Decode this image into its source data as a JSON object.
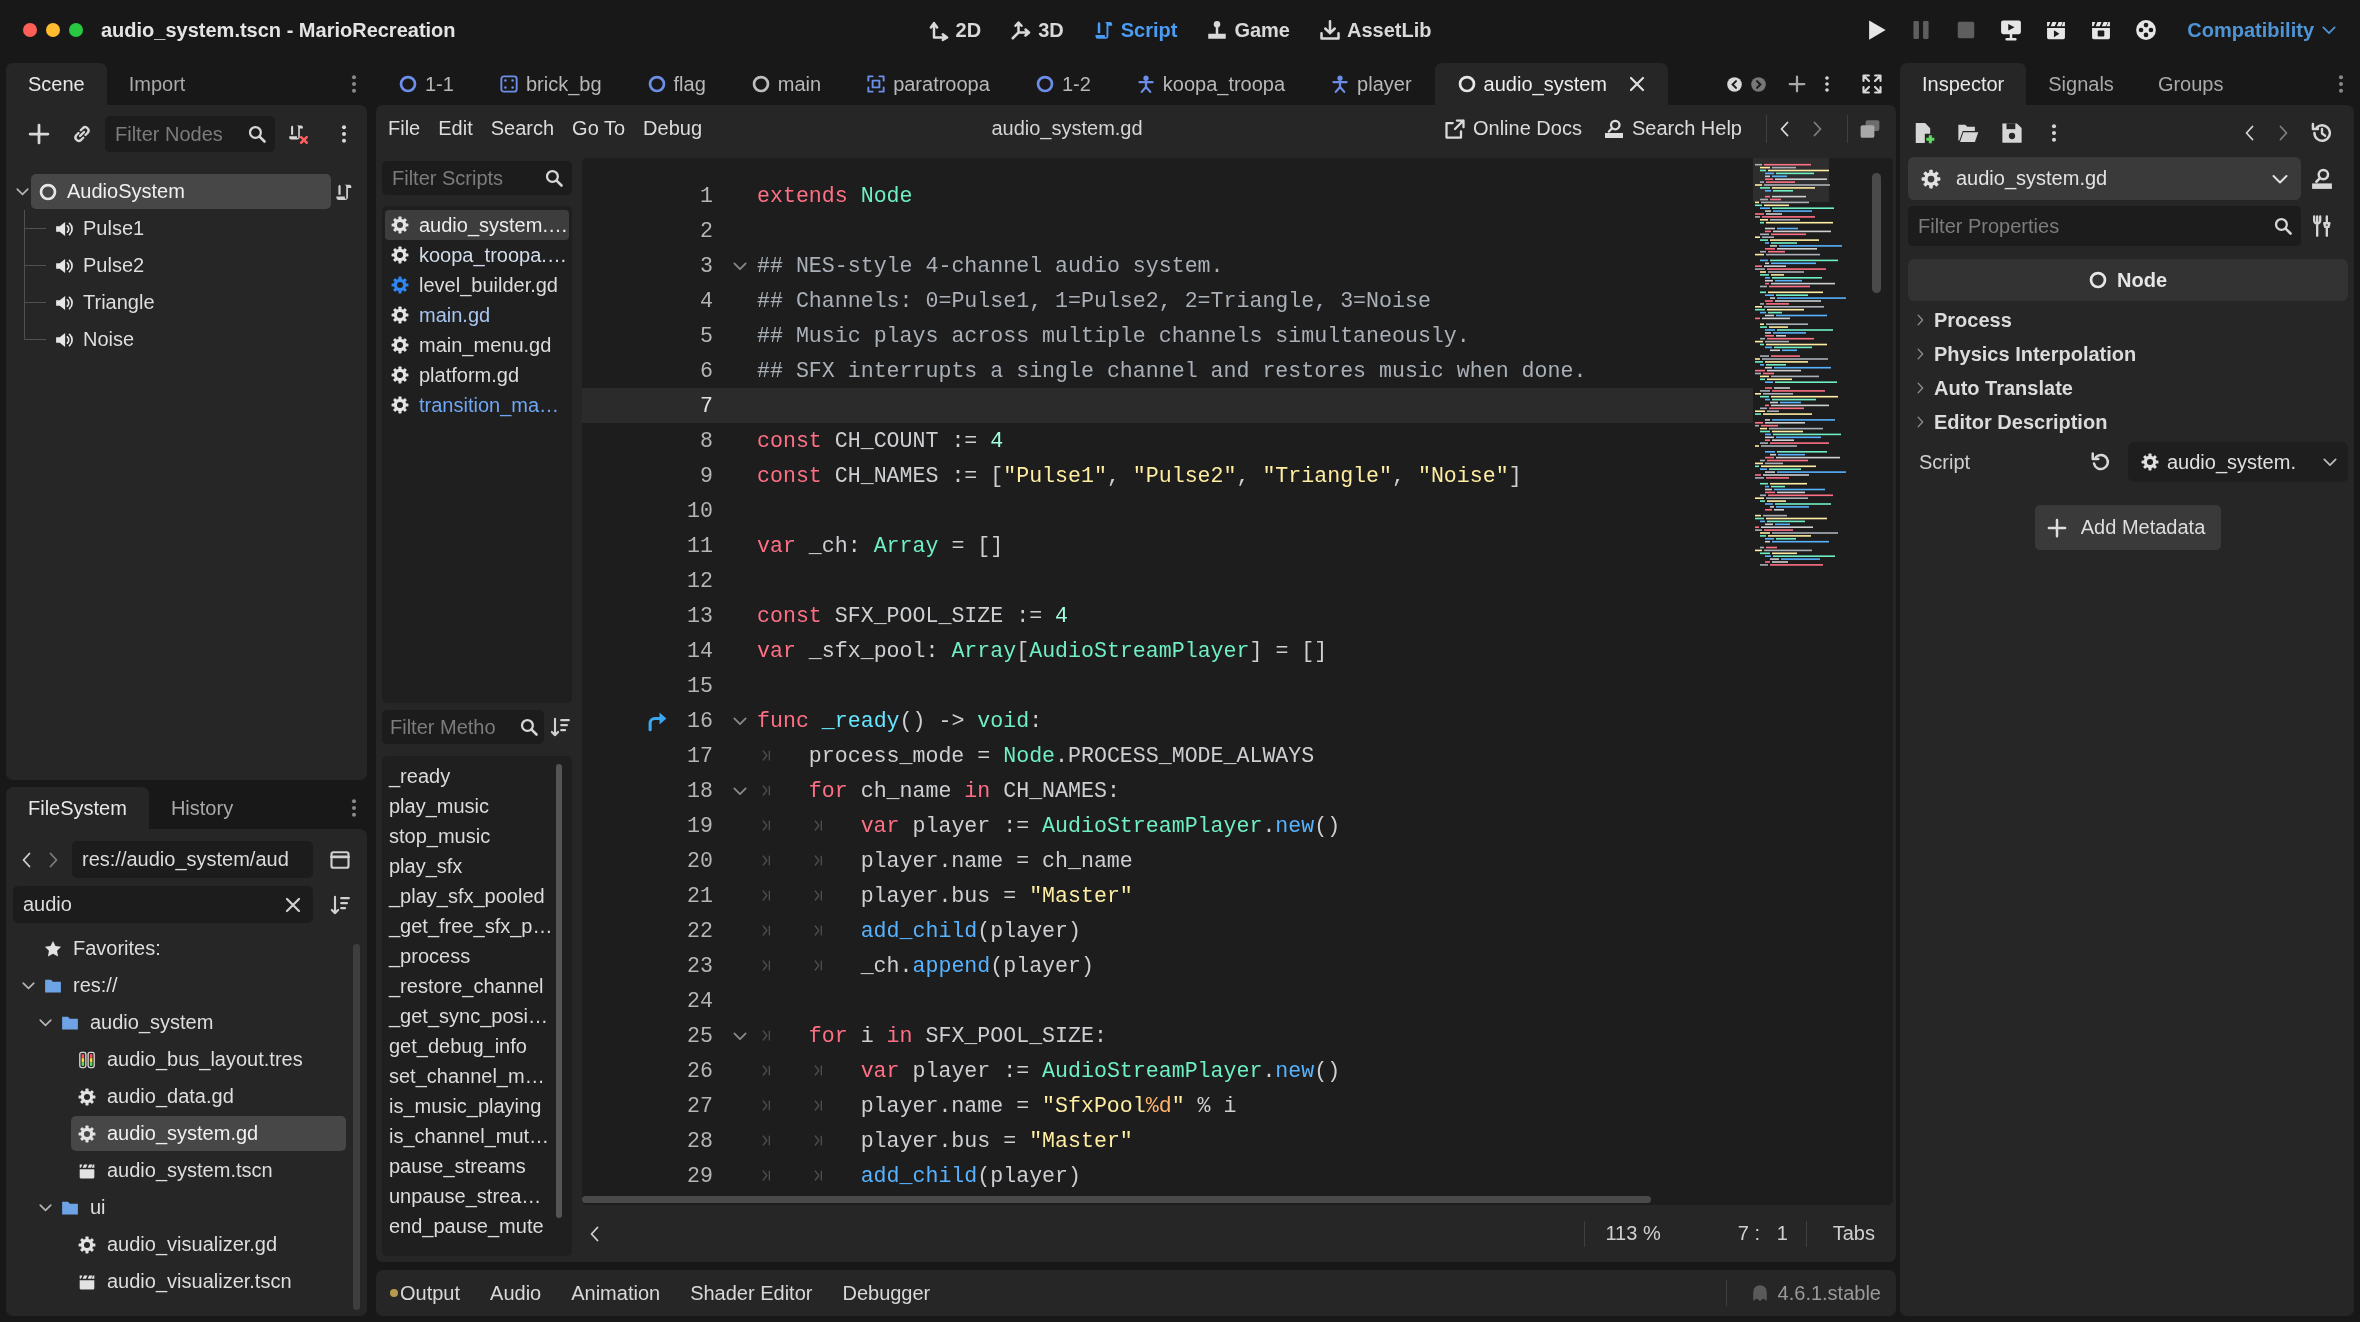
{
  "window": {
    "title": "audio_system.tscn - MarioRecreation"
  },
  "main_screens": [
    {
      "label": "2D",
      "kind": "canvas",
      "selected": false
    },
    {
      "label": "3D",
      "kind": "spatial",
      "selected": false
    },
    {
      "label": "Script",
      "kind": "script",
      "selected": true
    },
    {
      "label": "Game",
      "kind": "game",
      "selected": false
    },
    {
      "label": "AssetLib",
      "kind": "assetlib",
      "selected": false
    }
  ],
  "run_buttons": [
    {
      "kind": "play",
      "disabled": false
    },
    {
      "kind": "pause",
      "disabled": true
    },
    {
      "kind": "stop",
      "disabled": true
    },
    {
      "kind": "remote",
      "disabled": false
    },
    {
      "kind": "scene",
      "disabled": false
    },
    {
      "kind": "custom",
      "disabled": false
    },
    {
      "kind": "movie",
      "disabled": false
    }
  ],
  "renderer": "Compatibility",
  "scene_dock": {
    "tabs": [
      {
        "label": "Scene",
        "selected": true
      },
      {
        "label": "Import",
        "selected": false
      }
    ],
    "filter": {
      "placeholder": "Filter Nodes"
    },
    "tree": [
      {
        "label": "AudioSystem",
        "kind": "node",
        "selected": true,
        "expanded": true,
        "has_script": true,
        "children": [
          {
            "label": "Pulse1",
            "kind": "audio",
            "selected": false,
            "has_script": false
          },
          {
            "label": "Pulse2",
            "kind": "audio",
            "selected": false,
            "has_script": false
          },
          {
            "label": "Triangle",
            "kind": "audio",
            "selected": false,
            "has_script": false
          },
          {
            "label": "Noise",
            "kind": "audio",
            "selected": false,
            "has_script": false
          }
        ]
      }
    ]
  },
  "filesystem_dock": {
    "tabs": [
      {
        "label": "FileSystem",
        "selected": true
      },
      {
        "label": "History",
        "selected": false
      }
    ],
    "path": "res://audio_system/aud",
    "search": {
      "value": "audio"
    },
    "tree": [
      {
        "label": "Favorites:",
        "kind": "favorites",
        "selected": false
      },
      {
        "label": "res://",
        "kind": "folder",
        "selected": false,
        "expanded": true,
        "children": [
          {
            "label": "audio_system",
            "kind": "folder",
            "selected": false,
            "expanded": true,
            "children": [
              {
                "label": "audio_bus_layout.tres",
                "kind": "mixer",
                "selected": false
              },
              {
                "label": "audio_data.gd",
                "kind": "script",
                "selected": false
              },
              {
                "label": "audio_system.gd",
                "kind": "script",
                "selected": true
              },
              {
                "label": "audio_system.tscn",
                "kind": "scene",
                "selected": false
              }
            ]
          },
          {
            "label": "ui",
            "kind": "folder",
            "selected": false,
            "expanded": true,
            "children": [
              {
                "label": "audio_visualizer.gd",
                "kind": "script",
                "selected": false
              },
              {
                "label": "audio_visualizer.tscn",
                "kind": "scene",
                "selected": false
              }
            ]
          }
        ]
      }
    ]
  },
  "scene_tabs": [
    {
      "label": "1-1",
      "kind": "node",
      "color": "#6d8ee8",
      "selected": false
    },
    {
      "label": "brick_bg",
      "kind": "frame",
      "color": "#6d8ee8",
      "selected": false
    },
    {
      "label": "flag",
      "kind": "node",
      "color": "#6d8ee8",
      "selected": false
    },
    {
      "label": "main",
      "kind": "node",
      "color": "#bdbdbd",
      "selected": false
    },
    {
      "label": "paratroopa",
      "kind": "area",
      "color": "#6d8ee8",
      "selected": false
    },
    {
      "label": "1-2",
      "kind": "node",
      "color": "#6d8ee8",
      "selected": false
    },
    {
      "label": "koopa_troopa",
      "kind": "body",
      "color": "#6d8ee8",
      "selected": false
    },
    {
      "label": "player",
      "kind": "body",
      "color": "#6d8ee8",
      "selected": false
    },
    {
      "label": "audio_system",
      "kind": "node",
      "color": "#e6e6e6",
      "selected": true
    }
  ],
  "script_editor": {
    "menu": [
      "File",
      "Edit",
      "Search",
      "Go To",
      "Debug"
    ],
    "title": "audio_system.gd",
    "help_links": [
      {
        "label": "Online Docs",
        "kind": "docs"
      },
      {
        "label": "Search Help",
        "kind": "help"
      }
    ],
    "scripts_filter": {
      "placeholder": "Filter Scripts"
    },
    "scripts": [
      {
        "label": "audio_system.…",
        "kind": "script",
        "selected": true
      },
      {
        "label": "koopa_troopa.…",
        "kind": "script",
        "color": "#d2dcea",
        "selected": false
      },
      {
        "label": "level_builder.gd",
        "kind": "tool",
        "color": "#dcdcdc",
        "selected": false
      },
      {
        "label": "main.gd",
        "kind": "script",
        "color": "#a9c6f0",
        "selected": false
      },
      {
        "label": "main_menu.gd",
        "kind": "script",
        "color": "#dcdcdc",
        "selected": false
      },
      {
        "label": "platform.gd",
        "kind": "script",
        "color": "#dcdcdc",
        "selected": false
      },
      {
        "label": "transition_ma…",
        "kind": "script",
        "color": "#6fa7f4",
        "selected": false
      }
    ],
    "methods_filter": {
      "placeholder": "Filter Metho"
    },
    "methods": [
      {
        "label": "_ready",
        "selected": false
      },
      {
        "label": "play_music",
        "selected": false
      },
      {
        "label": "stop_music",
        "selected": false
      },
      {
        "label": "play_sfx",
        "selected": false
      },
      {
        "label": "_play_sfx_pooled",
        "selected": false
      },
      {
        "label": "_get_free_sfx_p…",
        "selected": false
      },
      {
        "label": "_process",
        "selected": false
      },
      {
        "label": "_restore_channel",
        "selected": false
      },
      {
        "label": "_get_sync_posi…",
        "selected": false
      },
      {
        "label": "get_debug_info",
        "selected": false
      },
      {
        "label": "set_channel_m…",
        "selected": false
      },
      {
        "label": "is_music_playing",
        "selected": false
      },
      {
        "label": "is_channel_mut…",
        "selected": false
      },
      {
        "label": "pause_streams",
        "selected": false
      },
      {
        "label": "unpause_strea…",
        "selected": false
      },
      {
        "label": "end_pause_mute",
        "selected": false
      }
    ],
    "code": [
      {
        "number": "1",
        "current": false,
        "foldable": false,
        "override": false,
        "tokens": [
          {
            "kind": "kw",
            "text": "extends"
          },
          {
            "kind": "type",
            "text": " Node"
          }
        ]
      },
      {
        "number": "2",
        "current": false,
        "foldable": false,
        "override": false
      },
      {
        "number": "3",
        "current": false,
        "foldable": true,
        "override": false,
        "tokens": [
          {
            "kind": "cmt",
            "text": "## NES-style 4-channel audio system."
          }
        ]
      },
      {
        "number": "4",
        "current": false,
        "foldable": false,
        "override": false,
        "tokens": [
          {
            "kind": "cmt",
            "text": "## Channels: 0=Pulse1, 1=Pulse2, 2=Triangle, 3=Noise"
          }
        ]
      },
      {
        "number": "5",
        "current": false,
        "foldable": false,
        "override": false,
        "tokens": [
          {
            "kind": "cmt",
            "text": "## Music plays across multiple channels simultaneously."
          }
        ]
      },
      {
        "number": "6",
        "current": false,
        "foldable": false,
        "override": false,
        "tokens": [
          {
            "kind": "cmt",
            "text": "## SFX interrupts a single channel and restores music when done."
          }
        ]
      },
      {
        "number": "7",
        "current": true,
        "foldable": false,
        "override": false
      },
      {
        "number": "8",
        "current": false,
        "foldable": false,
        "override": false,
        "tokens": [
          {
            "kind": "kw",
            "text": "const"
          },
          {
            "kind": "plain",
            "text": " CH_COUNT := "
          },
          {
            "kind": "num",
            "text": "4"
          }
        ]
      },
      {
        "number": "9",
        "current": false,
        "foldable": false,
        "override": false,
        "tokens": [
          {
            "kind": "kw",
            "text": "const"
          },
          {
            "kind": "plain",
            "text": " CH_NAMES := ["
          },
          {
            "kind": "str",
            "text": "\"Pulse1\""
          },
          {
            "kind": "plain",
            "text": ", "
          },
          {
            "kind": "str",
            "text": "\"Pulse2\""
          },
          {
            "kind": "plain",
            "text": ", "
          },
          {
            "kind": "str",
            "text": "\"Triangle\""
          },
          {
            "kind": "plain",
            "text": ", "
          },
          {
            "kind": "str",
            "text": "\"Noise\""
          },
          {
            "kind": "plain",
            "text": "]"
          }
        ]
      },
      {
        "number": "10",
        "current": false,
        "foldable": false,
        "override": false
      },
      {
        "number": "11",
        "current": false,
        "foldable": false,
        "override": false,
        "tokens": [
          {
            "kind": "kw",
            "text": "var"
          },
          {
            "kind": "plain",
            "text": " _ch: "
          },
          {
            "kind": "type",
            "text": "Array"
          },
          {
            "kind": "plain",
            "text": " = []"
          }
        ]
      },
      {
        "number": "12",
        "current": false,
        "foldable": false,
        "override": false
      },
      {
        "number": "13",
        "current": false,
        "foldable": false,
        "override": false,
        "tokens": [
          {
            "kind": "kw",
            "text": "const"
          },
          {
            "kind": "plain",
            "text": " SFX_POOL_SIZE := "
          },
          {
            "kind": "num",
            "text": "4"
          }
        ]
      },
      {
        "number": "14",
        "current": false,
        "foldable": false,
        "override": false,
        "tokens": [
          {
            "kind": "kw",
            "text": "var"
          },
          {
            "kind": "plain",
            "text": " _sfx_pool: "
          },
          {
            "kind": "type",
            "text": "Array"
          },
          {
            "kind": "plain",
            "text": "["
          },
          {
            "kind": "type",
            "text": "AudioStreamPlayer"
          },
          {
            "kind": "plain",
            "text": "] = []"
          }
        ]
      },
      {
        "number": "15",
        "current": false,
        "foldable": false,
        "override": false
      },
      {
        "number": "16",
        "current": false,
        "foldable": true,
        "override": true,
        "tokens": [
          {
            "kind": "kw",
            "text": "func"
          },
          {
            "kind": "def",
            "text": " _ready"
          },
          {
            "kind": "plain",
            "text": "() -> "
          },
          {
            "kind": "type",
            "text": "void"
          },
          {
            "kind": "plain",
            "text": ":"
          }
        ]
      },
      {
        "number": "17",
        "current": false,
        "foldable": false,
        "override": false,
        "tokens": [
          {
            "kind": "plain",
            "text": "\tprocess_mode = "
          },
          {
            "kind": "type",
            "text": "Node"
          },
          {
            "kind": "plain",
            "text": ".PROCESS_MODE_ALWAYS"
          }
        ]
      },
      {
        "number": "18",
        "current": false,
        "foldable": true,
        "override": false,
        "tokens": [
          {
            "kind": "kw",
            "text": "\tfor"
          },
          {
            "kind": "plain",
            "text": " ch_name "
          },
          {
            "kind": "kw",
            "text": "in"
          },
          {
            "kind": "plain",
            "text": " CH_NAMES:"
          }
        ]
      },
      {
        "number": "19",
        "current": false,
        "foldable": false,
        "override": false,
        "tokens": [
          {
            "kind": "kw",
            "text": "\t\tvar"
          },
          {
            "kind": "plain",
            "text": " player := "
          },
          {
            "kind": "type",
            "text": "AudioStreamPlayer"
          },
          {
            "kind": "plain",
            "text": "."
          },
          {
            "kind": "fn",
            "text": "new"
          },
          {
            "kind": "plain",
            "text": "()"
          }
        ]
      },
      {
        "number": "20",
        "current": false,
        "foldable": false,
        "override": false,
        "tokens": [
          {
            "kind": "plain",
            "text": "\t\tplayer.name = ch_name"
          }
        ]
      },
      {
        "number": "21",
        "current": false,
        "foldable": false,
        "override": false,
        "tokens": [
          {
            "kind": "plain",
            "text": "\t\tplayer.bus = "
          },
          {
            "kind": "str",
            "text": "\"Master\""
          }
        ]
      },
      {
        "number": "22",
        "current": false,
        "foldable": false,
        "override": false,
        "tokens": [
          {
            "kind": "fn",
            "text": "\t\tadd_child"
          },
          {
            "kind": "plain",
            "text": "(player)"
          }
        ]
      },
      {
        "number": "23",
        "current": false,
        "foldable": false,
        "override": false,
        "tokens": [
          {
            "kind": "plain",
            "text": "\t\t_ch."
          },
          {
            "kind": "fn",
            "text": "append"
          },
          {
            "kind": "plain",
            "text": "(player)"
          }
        ]
      },
      {
        "number": "24",
        "current": false,
        "foldable": false,
        "override": false
      },
      {
        "number": "25",
        "current": false,
        "foldable": true,
        "override": false,
        "tokens": [
          {
            "kind": "kw",
            "text": "\tfor"
          },
          {
            "kind": "plain",
            "text": " i "
          },
          {
            "kind": "kw",
            "text": "in"
          },
          {
            "kind": "plain",
            "text": " SFX_POOL_SIZE:"
          }
        ]
      },
      {
        "number": "26",
        "current": false,
        "foldable": false,
        "override": false,
        "tokens": [
          {
            "kind": "kw",
            "text": "\t\tvar"
          },
          {
            "kind": "plain",
            "text": " player := "
          },
          {
            "kind": "type",
            "text": "AudioStreamPlayer"
          },
          {
            "kind": "plain",
            "text": "."
          },
          {
            "kind": "fn",
            "text": "new"
          },
          {
            "kind": "plain",
            "text": "()"
          }
        ]
      },
      {
        "number": "27",
        "current": false,
        "foldable": false,
        "override": false,
        "tokens": [
          {
            "kind": "plain",
            "text": "\t\tplayer.name = "
          },
          {
            "kind": "str",
            "text": "\"SfxPool"
          },
          {
            "kind": "fmt",
            "text": "%d"
          },
          {
            "kind": "str",
            "text": "\""
          },
          {
            "kind": "plain",
            "text": " % i"
          }
        ]
      },
      {
        "number": "28",
        "current": false,
        "foldable": false,
        "override": false,
        "tokens": [
          {
            "kind": "plain",
            "text": "\t\tplayer.bus = "
          },
          {
            "kind": "str",
            "text": "\"Master\""
          }
        ]
      },
      {
        "number": "29",
        "current": false,
        "foldable": false,
        "override": false,
        "tokens": [
          {
            "kind": "fn",
            "text": "\t\tadd_child"
          },
          {
            "kind": "plain",
            "text": "(player)"
          }
        ]
      }
    ],
    "status": {
      "zoom": "113 %",
      "cursor": "7 :   1",
      "indent": "Tabs"
    }
  },
  "inspector": {
    "tabs": [
      {
        "label": "Inspector",
        "selected": true
      },
      {
        "label": "Signals",
        "selected": false
      },
      {
        "label": "Groups",
        "selected": false
      }
    ],
    "object": "audio_system.gd",
    "filter": {
      "placeholder": "Filter Properties"
    },
    "class_name": "Node",
    "sections": [
      {
        "label": "Process",
        "expanded": false
      },
      {
        "label": "Physics Interpolation",
        "expanded": false
      },
      {
        "label": "Auto Translate",
        "expanded": false
      },
      {
        "label": "Editor Description",
        "expanded": false
      }
    ],
    "properties": [
      {
        "label": "Script",
        "value": "audio_system.",
        "revertable": true
      }
    ],
    "add_metadata": "Add Metadata"
  },
  "bottom_panel": {
    "tabs": [
      {
        "label": "Output",
        "selected": false,
        "notify": true
      },
      {
        "label": "Audio",
        "selected": false,
        "notify": false
      },
      {
        "label": "Animation",
        "selected": false,
        "notify": false
      },
      {
        "label": "Shader Editor",
        "selected": false,
        "notify": false
      },
      {
        "label": "Debugger",
        "selected": false,
        "notify": false
      }
    ],
    "version": "4.6.1.stable"
  }
}
